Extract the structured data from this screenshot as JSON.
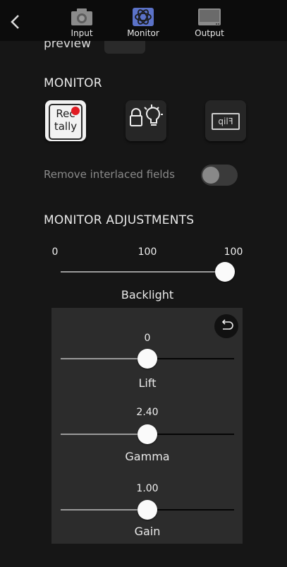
{
  "nav": {
    "tabs": [
      {
        "label": "Input",
        "icon": "camera-icon",
        "active": false
      },
      {
        "label": "Monitor",
        "icon": "atomos-logo-icon",
        "active": true
      },
      {
        "label": "Output",
        "icon": "display-icon",
        "active": false
      }
    ]
  },
  "preview": {
    "label": "preview"
  },
  "monitor": {
    "title": "MONITOR",
    "rec_tally": {
      "line1": "Rec",
      "line2": "tally",
      "accent": "#e11b22"
    },
    "flip_label": "Flip",
    "remove_interlaced": {
      "label": "Remove interlaced fields",
      "enabled": false
    }
  },
  "adjustments": {
    "title": "MONITOR ADJUSTMENTS",
    "backlight": {
      "min_label": "0",
      "value_label": "100",
      "max_label": "100",
      "name": "Backlight",
      "level": 1.0
    },
    "lift": {
      "value_label": "0",
      "name": "Lift",
      "level": 0.5
    },
    "gamma": {
      "value_label": "2.40",
      "name": "Gamma",
      "level": 0.5
    },
    "gain": {
      "value_label": "1.00",
      "name": "Gain",
      "level": 0.5
    }
  },
  "colors": {
    "accent_tab": "#5b72c8",
    "background": "#161616",
    "panel": "#2c2c2c"
  }
}
